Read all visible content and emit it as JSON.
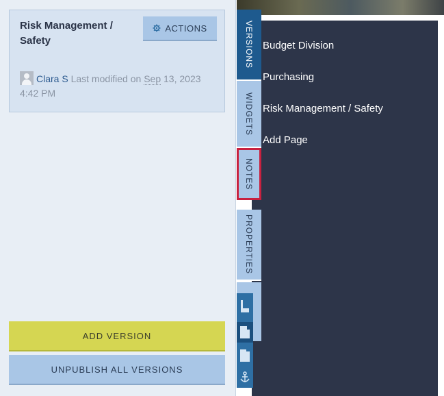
{
  "card": {
    "title": "Risk Management / Safety",
    "actions_label": "ACTIONS",
    "user": "Clara S",
    "modified_prefix": "Last modified on",
    "modified_date": "Sep",
    "modified_date_rest": "13, 2023",
    "modified_time": "4:42 PM"
  },
  "buttons": {
    "add_version": "ADD VERSION",
    "unpublish_all": "UNPUBLISH ALL VERSIONS"
  },
  "tabs": [
    {
      "label": "VERSIONS",
      "active": true
    },
    {
      "label": "WIDGETS",
      "active": false
    },
    {
      "label": "NOTES",
      "active": false,
      "highlighted": true
    },
    {
      "label": "PROPERTIES",
      "active": false
    }
  ],
  "pages": [
    {
      "label": "Budget Division"
    },
    {
      "label": "Purchasing"
    },
    {
      "label": "Risk Management / Safety"
    },
    {
      "label": "Add Page"
    }
  ],
  "tools": [
    "layout-small-icon",
    "layout-medium-icon",
    "layout-large-icon",
    "anchor-icon"
  ],
  "colors": {
    "panel_dark": "#2d3549",
    "tab_active": "#1e5a8e",
    "tab_inactive": "#a9c6e6",
    "add_version": "#d5d652",
    "highlight": "#c8213f"
  }
}
